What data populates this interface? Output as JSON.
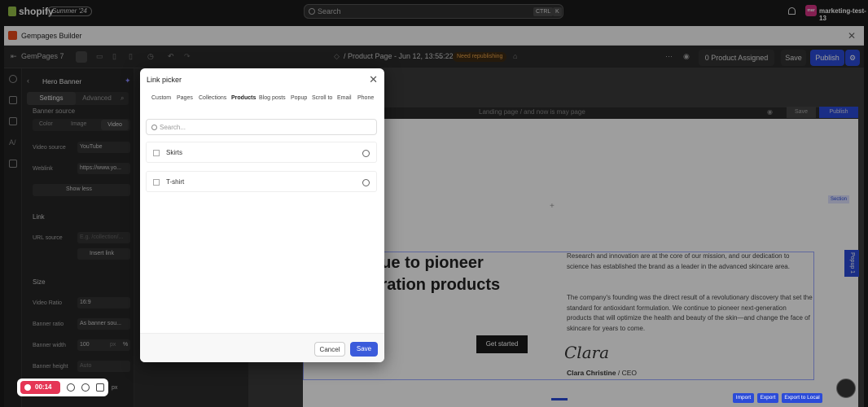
{
  "shopify": {
    "brand": "shopify",
    "edition": "Summer '24",
    "search_placeholder": "Search",
    "kbd1": "CTRL",
    "kbd2": "K",
    "avatar": "mar",
    "store": "marketing-test-13"
  },
  "window": {
    "title": "Gempages Builder"
  },
  "toolbar": {
    "app": "GemPages 7",
    "page": "/ Product Page - Jun 12, 13:55:22",
    "status": "Need republishing",
    "assigned": "0 Product Assigned",
    "save": "Save",
    "publish": "Publish"
  },
  "panel": {
    "title": "Hero Banner",
    "tab_settings": "Settings",
    "tab_advanced": "Advanced",
    "banner_source": "Banner source",
    "src_color": "Color",
    "src_image": "Image",
    "src_video": "Video",
    "video_source_label": "Video source",
    "video_source_val": "YouTube",
    "weblink_label": "Weblink",
    "weblink_val": "https://www.yo...",
    "show_less": "Show less",
    "link_title": "Link",
    "url_source_label": "URL source",
    "url_placeholder": "E.g. /collection/...",
    "insert_link": "Insert link",
    "size_title": "Size",
    "video_ratio_label": "Video Ratio",
    "video_ratio_val": "16:9",
    "banner_ratio_label": "Banner ratio",
    "banner_ratio_val": "As banner sou...",
    "banner_width_label": "Banner width",
    "banner_width_val": "100",
    "banner_width_unit": "px",
    "banner_width_pct": "%",
    "banner_height_label": "Banner height",
    "banner_height_val": "Auto",
    "unit_px": "px"
  },
  "canvas": {
    "breadcrumb": "Landing page / and now is may page",
    "save": "Save",
    "publish": "Publish",
    "section": "Section",
    "heading": "We continue to pioneer next-generation products",
    "body1": "Research and innovation are at the core of our mission, and our dedication to science has established the brand as a leader in the advanced skincare area.",
    "body2": "The company's founding was the direct result of a revolutionary discovery that set the standard for antioxidant formulation. We continue to pioneer next-generation products that will optimize the health and beauty of the skin—and change the face of skincare for years to come.",
    "cta": "Get started",
    "signature": "Clara",
    "sig_name": "Clara Christine",
    "sig_role": "/ CEO",
    "popup": "Popup 1"
  },
  "modal": {
    "title": "Link picker",
    "tabs": [
      "Custom",
      "Pages",
      "Collections",
      "Products",
      "Blog posts",
      "Popup",
      "Scroll to",
      "Email",
      "Phone"
    ],
    "active_tab": "Products",
    "search_placeholder": "Search...",
    "items": [
      "Skirts",
      "T-shirt"
    ],
    "cancel": "Cancel",
    "save": "Save"
  },
  "recorder": {
    "time": "00:14"
  },
  "bottom": {
    "import": "Import",
    "export": "Export",
    "export_local": "Export to Local"
  }
}
